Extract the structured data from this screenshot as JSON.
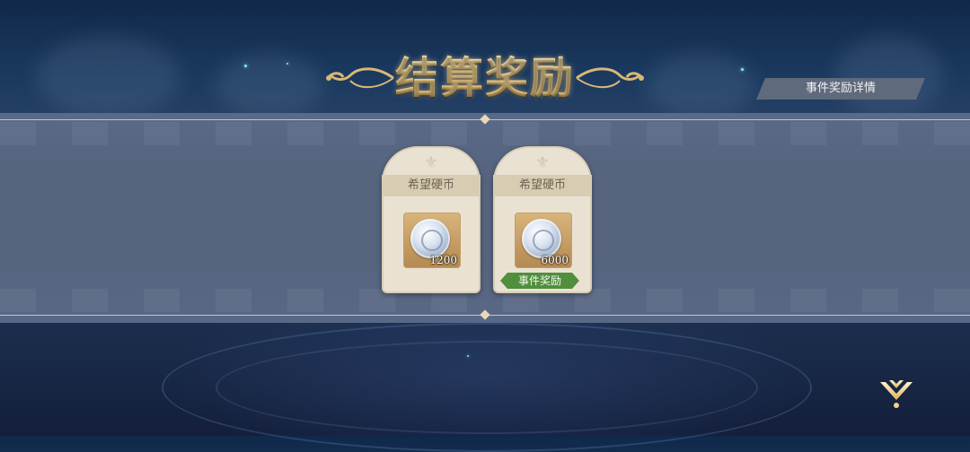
{
  "header": {
    "title": "结算奖励",
    "detail_button_label": "事件奖励详情"
  },
  "rewards": [
    {
      "name": "希望硬币",
      "quantity": "1200",
      "icon": "silver-coin-icon",
      "tag": ""
    },
    {
      "name": "希望硬币",
      "quantity": "6000",
      "icon": "silver-coin-icon",
      "tag": "事件奖励"
    }
  ],
  "footer": {
    "continue_icon": "chevron-down-icon"
  },
  "colors": {
    "title_gold": "#f0c66f",
    "band": "#56647e",
    "card": "#e9e2d2",
    "event_tag": "#4f8f3d"
  }
}
